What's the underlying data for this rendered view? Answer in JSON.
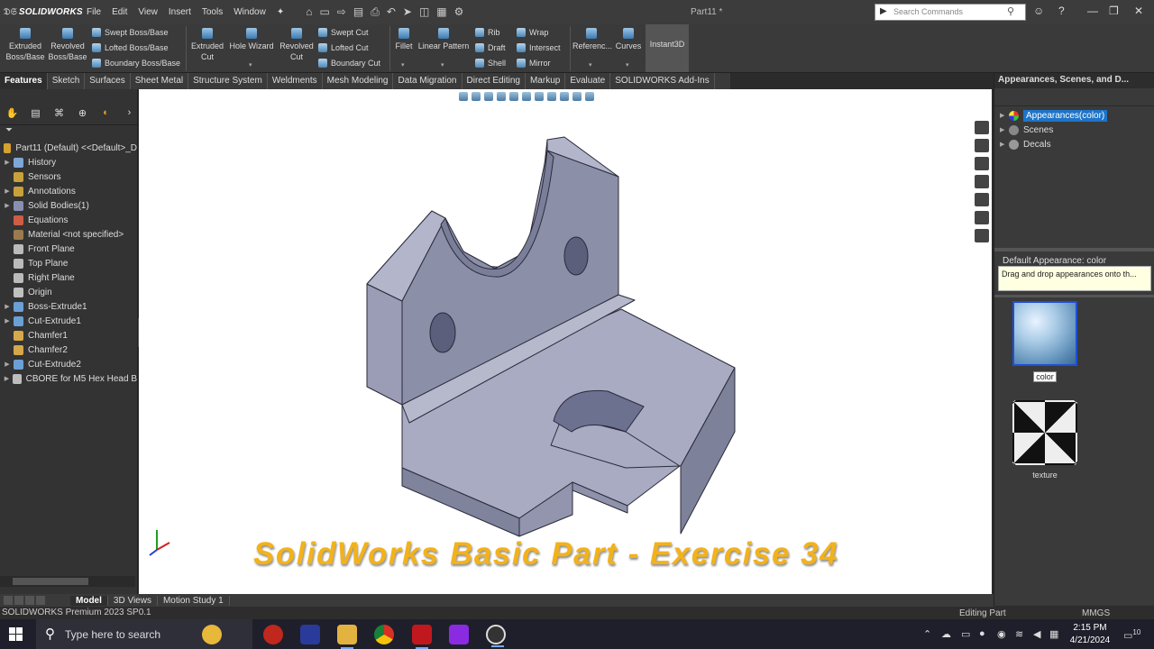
{
  "titlebar": {
    "app_logo": "SOLIDWORKS",
    "menus": [
      "File",
      "Edit",
      "View",
      "Insert",
      "Tools",
      "Window"
    ],
    "doc_title": "Part11 *",
    "search_placeholder": "Search Commands"
  },
  "ribbon": {
    "extruded_boss": "Extruded Boss/Base",
    "revolved_boss": "Revolved Boss/Base",
    "swept_boss": "Swept Boss/Base",
    "lofted_boss": "Lofted Boss/Base",
    "boundary_boss": "Boundary Boss/Base",
    "extruded_cut": "Extruded Cut",
    "hole_wizard": "Hole Wizard",
    "revolved_cut": "Revolved Cut",
    "swept_cut": "Swept Cut",
    "lofted_cut": "Lofted Cut",
    "boundary_cut": "Boundary Cut",
    "fillet": "Fillet",
    "linear_pattern": "Linear Pattern",
    "rib": "Rib",
    "draft": "Draft",
    "shell": "Shell",
    "wrap": "Wrap",
    "intersect": "Intersect",
    "mirror": "Mirror",
    "reference": "Referenc...",
    "curves": "Curves",
    "instant3d": "Instant3D"
  },
  "tabs": [
    "Features",
    "Sketch",
    "Surfaces",
    "Sheet Metal",
    "Structure System",
    "Weldments",
    "Mesh Modeling",
    "Data Migration",
    "Direct Editing",
    "Markup",
    "Evaluate",
    "SOLIDWORKS Add-Ins"
  ],
  "tree": {
    "root": "Part11 (Default) <<Default>_D",
    "items": [
      {
        "label": "History",
        "expand": true,
        "icon": "history-icon"
      },
      {
        "label": "Sensors",
        "expand": false,
        "icon": "sensor-icon"
      },
      {
        "label": "Annotations",
        "expand": true,
        "icon": "annotations-icon"
      },
      {
        "label": "Solid Bodies(1)",
        "expand": true,
        "icon": "solid-bodies-icon"
      },
      {
        "label": "Equations",
        "expand": false,
        "icon": "equations-icon"
      },
      {
        "label": "Material <not specified>",
        "expand": false,
        "icon": "material-icon"
      },
      {
        "label": "Front Plane",
        "expand": false,
        "icon": "plane-icon"
      },
      {
        "label": "Top Plane",
        "expand": false,
        "icon": "plane-icon"
      },
      {
        "label": "Right Plane",
        "expand": false,
        "icon": "plane-icon"
      },
      {
        "label": "Origin",
        "expand": false,
        "icon": "origin-icon"
      },
      {
        "label": "Boss-Extrude1",
        "expand": true,
        "icon": "boss-extrude-icon"
      },
      {
        "label": "Cut-Extrude1",
        "expand": true,
        "icon": "cut-extrude-icon"
      },
      {
        "label": "Chamfer1",
        "expand": false,
        "icon": "chamfer-icon"
      },
      {
        "label": "Chamfer2",
        "expand": false,
        "icon": "chamfer-icon"
      },
      {
        "label": "Cut-Extrude2",
        "expand": true,
        "icon": "cut-extrude-icon"
      },
      {
        "label": "CBORE for M5 Hex Head B",
        "expand": true,
        "icon": "hole-icon"
      }
    ]
  },
  "viewport": {
    "watermark": "SolidWorks Basic Part - Exercise 34",
    "part_color": "#9a9fb8"
  },
  "appearances": {
    "header": "Appearances, Scenes, and D...",
    "tree": [
      {
        "label": "Appearances(color)",
        "selected": true
      },
      {
        "label": "Scenes",
        "selected": false
      },
      {
        "label": "Decals",
        "selected": false
      }
    ],
    "default_label": "Default Appearance: color",
    "tip": "Drag and drop appearances onto th...",
    "swatches": [
      {
        "label": "color",
        "selected": true
      },
      {
        "label": "texture",
        "selected": false
      }
    ]
  },
  "bottom_tabs": [
    "Model",
    "3D Views",
    "Motion Study 1"
  ],
  "status": {
    "version": "SOLIDWORKS Premium 2023 SP0.1",
    "mode": "Editing Part",
    "units": "MMGS"
  },
  "taskbar": {
    "search_placeholder": "Type here to search",
    "time": "2:15 PM",
    "date": "4/21/2024",
    "notifications": "10"
  }
}
